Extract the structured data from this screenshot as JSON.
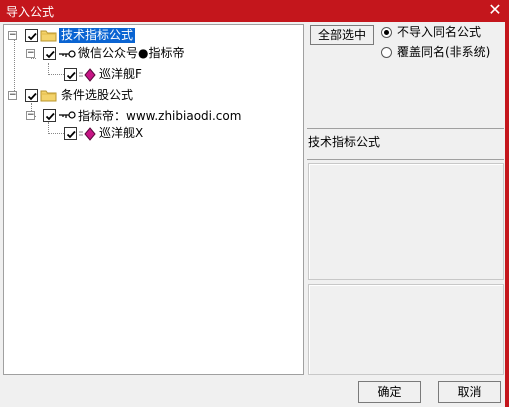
{
  "window": {
    "title": "导入公式",
    "close_glyph": "✕"
  },
  "tree": {
    "nodes": [
      {
        "label": "技术指标公式",
        "checked": true,
        "selected": true,
        "icon": "folder-icon"
      },
      {
        "label": "微信公众号●指标帝",
        "checked": true,
        "icon": "key-icon"
      },
      {
        "label": "巡洋舰F",
        "checked": true,
        "icon": "formula-diamond-icon"
      },
      {
        "label": "条件选股公式",
        "checked": true,
        "icon": "folder-icon"
      },
      {
        "label": "指标帝：www.zhibiaodi.com",
        "checked": true,
        "icon": "key-icon"
      },
      {
        "label": "巡洋舰X",
        "checked": true,
        "icon": "formula-diamond-icon"
      }
    ],
    "expander_glyph": "−"
  },
  "options": {
    "select_all_label": "全部选中",
    "radio_skip_label": "不导入同名公式",
    "radio_overwrite_label": "覆盖同名(非系统)",
    "selected": "skip"
  },
  "info": {
    "type_label": "技术指标公式"
  },
  "footer": {
    "ok_label": "确定",
    "cancel_label": "取消"
  },
  "colors": {
    "titlebar": "#c4161c",
    "selection": "#0a64d2",
    "diamond": "#c71585"
  }
}
